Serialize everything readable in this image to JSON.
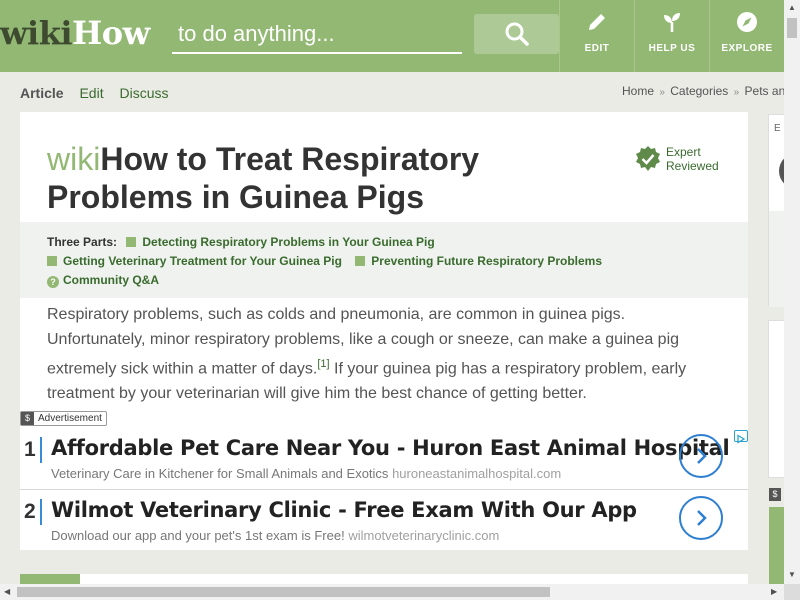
{
  "header": {
    "logo_wiki": "wiki",
    "logo_how": "How",
    "search_placeholder": "to do anything...",
    "nav": [
      {
        "label": "EDIT",
        "icon": "pencil-icon"
      },
      {
        "label": "HELP US",
        "icon": "sprout-icon"
      },
      {
        "label": "EXPLORE",
        "icon": "compass-icon"
      }
    ],
    "colors": {
      "brand": "#93b874",
      "link": "#3a6b2e"
    }
  },
  "subnav": {
    "tabs": [
      "Article",
      "Edit",
      "Discuss"
    ],
    "active_tab": "Article",
    "breadcrumbs": [
      "Home",
      "Categories",
      "Pets and"
    ],
    "breadcrumb_sep": "»"
  },
  "article": {
    "title_wiki": "wiki",
    "title": "How to Treat Respiratory Problems in Guinea Pigs",
    "badge_line1": "Expert",
    "badge_line2": "Reviewed",
    "parts_heading": "Three Parts:",
    "parts": [
      "Detecting Respiratory Problems in Your Guinea Pig",
      "Getting Veterinary Treatment for Your Guinea Pig",
      "Preventing Future Respiratory Problems"
    ],
    "qa_label": "Community Q&A",
    "intro_part1": "Respiratory problems, such as colds and pneumonia, are common in guinea pigs. Unfortunately, minor respiratory problems, like a cough or sneeze, can make a guinea pig extremely sick within a matter of days.",
    "intro_ref": "[1]",
    "intro_part2": " If your guinea pig has a respiratory problem, early treatment by your veterinarian will give him the best chance of getting better."
  },
  "ads": {
    "tag_symbol": "$",
    "tag_label": "Advertisement",
    "items": [
      {
        "num": "1",
        "headline": "Affordable Pet Care Near You - Huron East Animal Hospital",
        "desc": "Veterinary Care in Kitchener for Small Animals and Exotics",
        "url": "huroneastanimalhospital.com"
      },
      {
        "num": "2",
        "headline": "Wilmot Veterinary Clinic - Free Exam With Our App",
        "desc": "Download our app and your pet's 1st exam is Free!",
        "url": "wilmotveterinaryclinic.com"
      }
    ]
  },
  "sidebar": {
    "letter": "E",
    "ad_symbol": "$"
  }
}
